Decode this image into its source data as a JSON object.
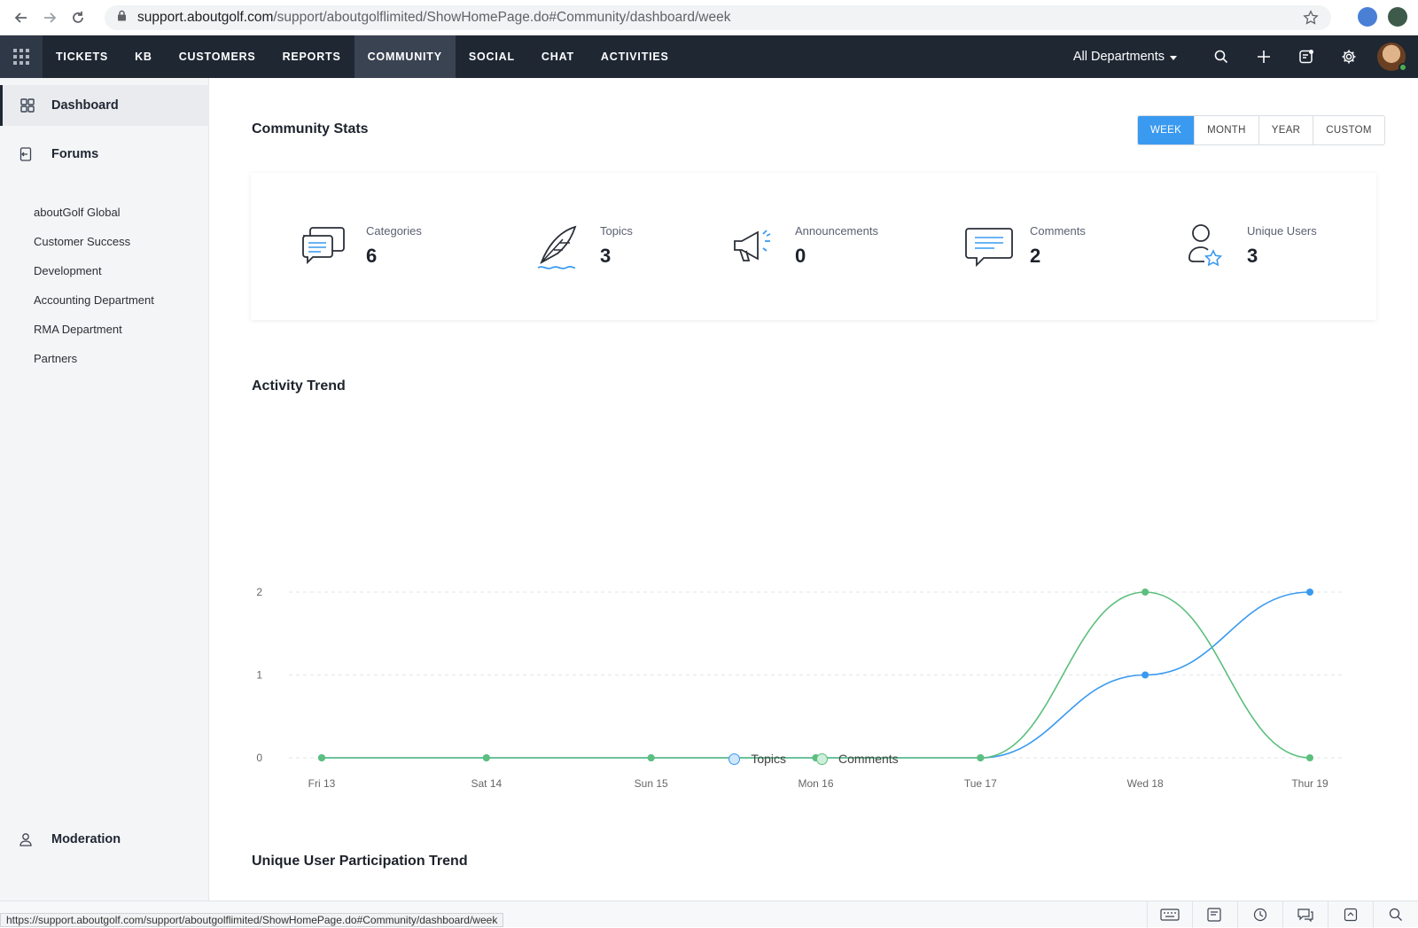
{
  "browser": {
    "url_host": "support.aboutgolf.com",
    "url_path": "/support/aboutgolflimited/ShowHomePage.do#Community/dashboard/week",
    "status_url": "https://support.aboutgolf.com/support/aboutgolflimited/ShowHomePage.do#Community/dashboard/week"
  },
  "header": {
    "tabs": [
      {
        "label": "TICKETS"
      },
      {
        "label": "KB"
      },
      {
        "label": "CUSTOMERS"
      },
      {
        "label": "REPORTS"
      },
      {
        "label": "COMMUNITY",
        "active": true
      },
      {
        "label": "SOCIAL"
      },
      {
        "label": "CHAT"
      },
      {
        "label": "ACTIVITIES"
      }
    ],
    "department": "All Departments",
    "icons": [
      "search-icon",
      "plus-icon",
      "notes-icon",
      "gear-icon"
    ]
  },
  "sidebar": {
    "dashboard": "Dashboard",
    "forums": "Forums",
    "forum_items": [
      "aboutGolf Global",
      "Customer Success",
      "Development",
      "Accounting Department",
      "RMA Department",
      "Partners"
    ],
    "moderation": "Moderation"
  },
  "main": {
    "stats_title": "Community Stats",
    "range_buttons": [
      "WEEK",
      "MONTH",
      "YEAR",
      "CUSTOM"
    ],
    "range_active": "WEEK",
    "stats": [
      {
        "label": "Categories",
        "value": "6",
        "icon": "chat-bubbles-icon"
      },
      {
        "label": "Topics",
        "value": "3",
        "icon": "quill-icon"
      },
      {
        "label": "Announcements",
        "value": "0",
        "icon": "megaphone-icon"
      },
      {
        "label": "Comments",
        "value": "2",
        "icon": "comment-icon"
      },
      {
        "label": "Unique Users",
        "value": "3",
        "icon": "user-star-icon"
      }
    ],
    "activity_title": "Activity Trend",
    "unique_title": "Unique User Participation Trend"
  },
  "chart_data": {
    "type": "line",
    "title": "Activity Trend",
    "categories": [
      "Fri 13",
      "Sat 14",
      "Sun 15",
      "Mon 16",
      "Tue 17",
      "Wed 18",
      "Thur 19"
    ],
    "series": [
      {
        "name": "Topics",
        "values": [
          0,
          0,
          0,
          0,
          0,
          1,
          2
        ],
        "color": "#3a9af0"
      },
      {
        "name": "Comments",
        "values": [
          0,
          0,
          0,
          0,
          0,
          2,
          0
        ],
        "color": "#5cbf7d"
      }
    ],
    "yticks": [
      "0",
      "1",
      "2"
    ],
    "ylim": [
      0,
      2
    ],
    "legend": "bottom-center",
    "grid": true
  }
}
